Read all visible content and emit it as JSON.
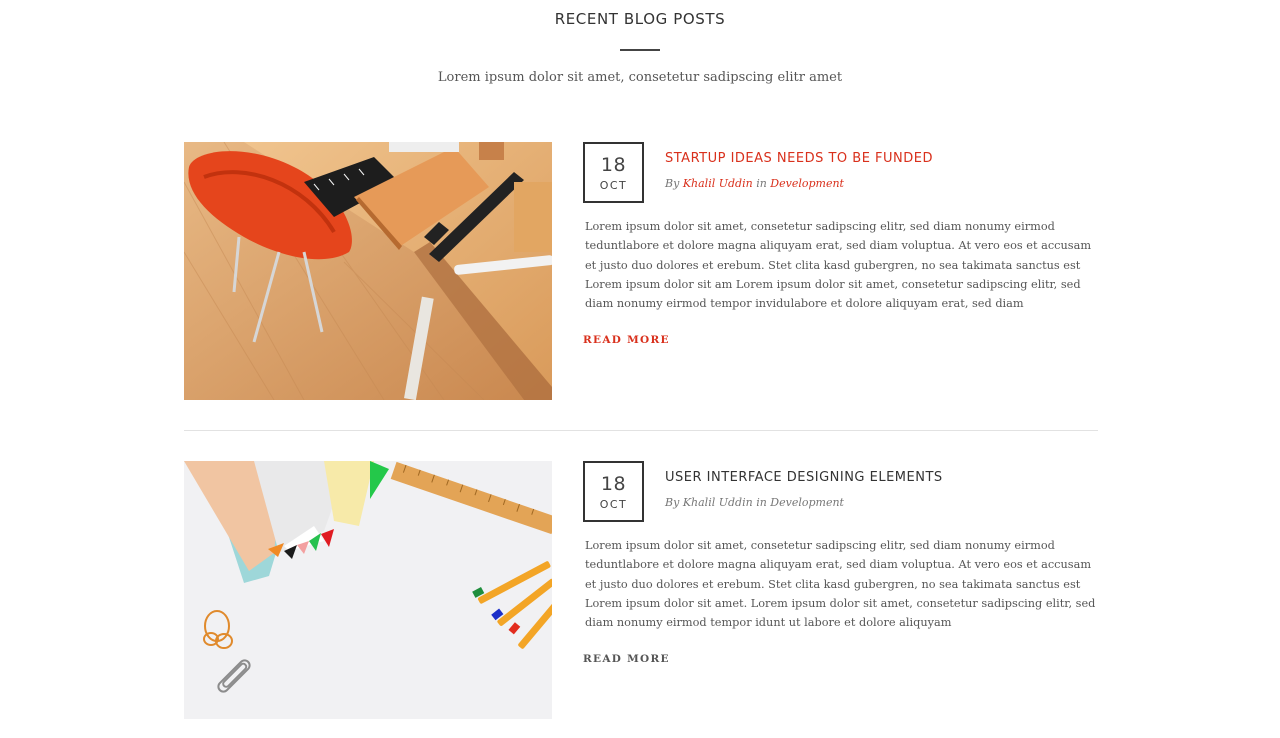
{
  "section": {
    "title": "RECENT BLOG POSTS",
    "subtitle": "Lorem ipsum dolor sit amet, consetetur sadipscing elitr amet"
  },
  "colors": {
    "accent": "#d9301c",
    "text": "#555555",
    "heading": "#333333",
    "divider": "#e2e2e2"
  },
  "posts": [
    {
      "date_day": "18",
      "date_month": "OCT",
      "title": "STARTUP IDEAS NEEDS TO BE FUNDED",
      "meta_by": "By",
      "author": "Khalil Uddin",
      "meta_in": "in",
      "category": "Development",
      "excerpt": "Lorem ipsum dolor sit amet, consetetur sadipscing elitr, sed diam nonumy eirmod teduntlabore et dolore magna aliquyam erat, sed diam voluptua. At vero eos et accusam et justo duo dolores et erebum. Stet clita kasd gubergren, no sea takimata sanctus est Lorem ipsum dolor sit am Lorem ipsum dolor sit amet, consetetur sadipscing elitr, sed diam nonumy eirmod tempor invidulabore et dolore aliquyam erat, sed diam",
      "read_more": "READ MORE",
      "image_icon": "desk-chair-notebook-photo"
    },
    {
      "date_day": "18",
      "date_month": "OCT",
      "title": "USER INTERFACE DESIGNING ELEMENTS",
      "meta_by": "By",
      "author": "Khalil Uddin",
      "meta_in": "in",
      "category": "Development",
      "excerpt": "Lorem ipsum dolor sit amet, consetetur sadipscing elitr, sed diam nonumy eirmod teduntlabore et dolore magna aliquyam erat, sed diam voluptua. At vero eos et accusam et justo duo dolores et erebum. Stet clita kasd gubergren, no sea takimata sanctus est Lorem ipsum dolor sit amet. Lorem ipsum dolor sit amet, consetetur sadipscing elitr, sed diam nonumy eirmod tempor idunt ut labore et dolore aliquyam",
      "read_more": "READ MORE",
      "image_icon": "paper-ruler-pens-photo"
    }
  ]
}
